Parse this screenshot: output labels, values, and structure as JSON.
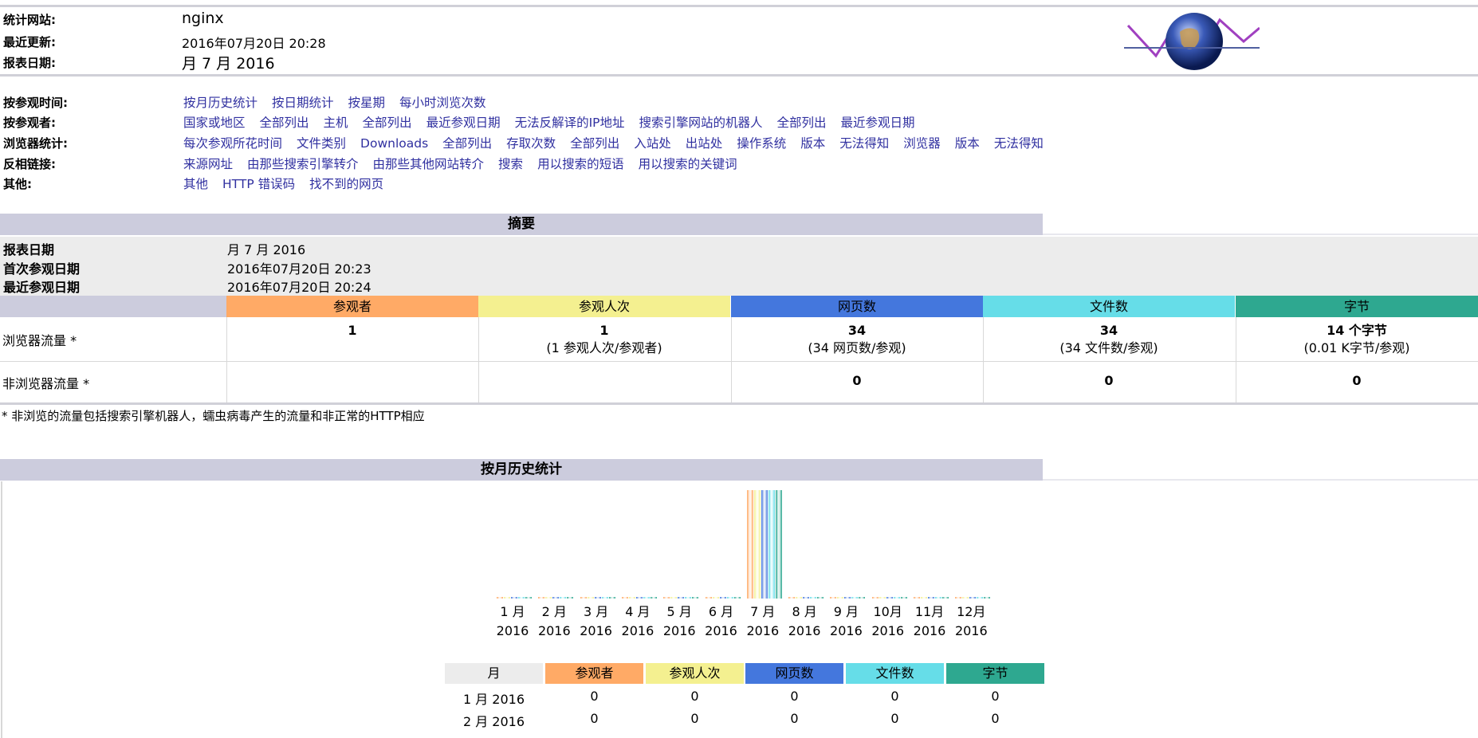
{
  "header": {
    "site_label": "统计网站:",
    "site_value": "nginx",
    "updated_label": "最近更新:",
    "updated_value": "2016年07月20日 20:28",
    "period_label": "报表日期:",
    "period_value": "月 7 月 2016"
  },
  "nav": {
    "rows": [
      {
        "label": "按参观时间:",
        "links": [
          "按月历史统计",
          "按日期统计",
          "按星期",
          "每小时浏览次数"
        ]
      },
      {
        "label": "按参观者:",
        "links": [
          "国家或地区",
          "全部列出",
          "主机",
          "全部列出",
          "最近参观日期",
          "无法反解译的IP地址",
          "搜索引擎网站的机器人",
          "全部列出",
          "最近参观日期"
        ]
      },
      {
        "label": "浏览器统计:",
        "links": [
          "每次参观所花时间",
          "文件类别",
          "Downloads",
          "全部列出",
          "存取次数",
          "全部列出",
          "入站处",
          "出站处",
          "操作系统",
          "版本",
          "无法得知",
          "浏览器",
          "版本",
          "无法得知"
        ]
      },
      {
        "label": "反相链接:",
        "links": [
          "来源网址",
          "由那些搜索引擎转介",
          "由那些其他网站转介",
          "搜索",
          "用以搜索的短语",
          "用以搜索的关键词"
        ]
      },
      {
        "label": "其他:",
        "links": [
          "其他",
          "HTTP 错误码",
          "找不到的网页"
        ]
      }
    ]
  },
  "summary": {
    "title": "摘要",
    "period_label": "报表日期",
    "period_value": "月 7 月 2016",
    "first_label": "首次参观日期",
    "first_value": "2016年07月20日 20:23",
    "last_label": "最近参观日期",
    "last_value": "2016年07月20日 20:24",
    "columns": [
      "参观者",
      "参观人次",
      "网页数",
      "文件数",
      "字节"
    ],
    "colors": [
      "#ffaa66",
      "#f4f090",
      "#4477dd",
      "#66dde8",
      "#2ea890"
    ],
    "browser_label": "浏览器流量 *",
    "browser_values": [
      "1",
      "1",
      "34",
      "34",
      "14 个字节"
    ],
    "browser_sub": [
      "",
      "(1 参观人次/参观者)",
      "(34 网页数/参观)",
      "(34 文件数/参观)",
      "(0.01 K字节/参观)"
    ],
    "nonbrowser_label": "非浏览器流量 *",
    "nonbrowser_values": [
      "",
      "",
      "0",
      "0",
      "0"
    ],
    "footnote": "* 非浏览的流量包括搜索引擎机器人，蠕虫病毒产生的流量和非正常的HTTP相应"
  },
  "monthly": {
    "title": "按月历史统计",
    "chart_data": {
      "type": "bar",
      "categories": [
        "1 月 2016",
        "2 月 2016",
        "3 月 2016",
        "4 月 2016",
        "5 月 2016",
        "6 月 2016",
        "7 月 2016",
        "8 月 2016",
        "9 月 2016",
        "10月 2016",
        "11月 2016",
        "12月 2016"
      ],
      "series": [
        {
          "name": "参观者",
          "values": [
            0,
            0,
            0,
            0,
            0,
            0,
            1,
            0,
            0,
            0,
            0,
            0
          ]
        },
        {
          "name": "参观人次",
          "values": [
            0,
            0,
            0,
            0,
            0,
            0,
            1,
            0,
            0,
            0,
            0,
            0
          ]
        },
        {
          "name": "网页数",
          "values": [
            0,
            0,
            0,
            0,
            0,
            0,
            34,
            0,
            0,
            0,
            0,
            0
          ]
        },
        {
          "name": "文件数",
          "values": [
            0,
            0,
            0,
            0,
            0,
            0,
            34,
            0,
            0,
            0,
            0,
            0
          ]
        },
        {
          "name": "字节",
          "values": [
            0,
            0,
            0,
            0,
            0,
            0,
            14,
            0,
            0,
            0,
            0,
            0
          ]
        }
      ]
    },
    "month_top": [
      "1 月",
      "2 月",
      "3 月",
      "4 月",
      "5 月",
      "6 月",
      "7 月",
      "8 月",
      "9 月",
      "10月",
      "11月",
      "12月"
    ],
    "month_bottom": [
      "2016",
      "2016",
      "2016",
      "2016",
      "2016",
      "2016",
      "2016",
      "2016",
      "2016",
      "2016",
      "2016",
      "2016"
    ],
    "table_headers": [
      "月",
      "参观者",
      "参观人次",
      "网页数",
      "文件数",
      "字节"
    ],
    "table_rows": [
      [
        "1 月 2016",
        "0",
        "0",
        "0",
        "0",
        "0"
      ],
      [
        "2 月 2016",
        "0",
        "0",
        "0",
        "0",
        "0"
      ]
    ]
  }
}
